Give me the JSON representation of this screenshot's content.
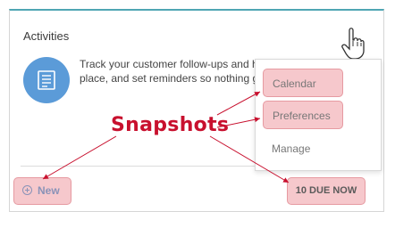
{
  "card": {
    "title": "Activities",
    "description": "Track your customer follow-ups and h place, and set reminders so nothing g"
  },
  "menu": {
    "items": [
      "Calendar",
      "Preferences",
      "Manage"
    ]
  },
  "buttons": {
    "new_label": "New",
    "due_label": "10 DUE NOW"
  },
  "annotation": {
    "label": "Snapshots",
    "color": "#c8102e",
    "highlight_color": "#f6c8cc"
  },
  "icons": {
    "activity": "notepad-icon",
    "menu": "kebab-menu-icon",
    "cursor": "hand-pointer-icon",
    "new": "plus-circle-icon"
  }
}
